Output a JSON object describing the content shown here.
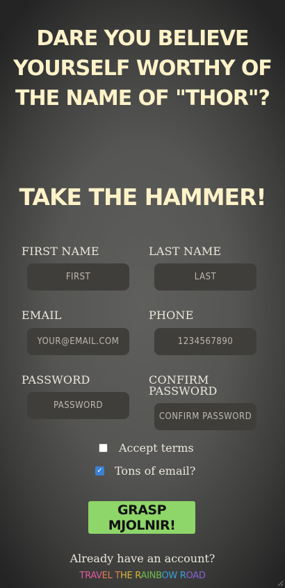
{
  "header": {
    "headline": "Dare you believe yourself worthy of the name of \"Thor\"?",
    "subhead": "Take the hammer!"
  },
  "form": {
    "first_name": {
      "label": "First Name",
      "placeholder": "First"
    },
    "last_name": {
      "label": "Last Name",
      "placeholder": "Last"
    },
    "email": {
      "label": "Email",
      "placeholder": "your@email.com"
    },
    "phone": {
      "label": "Phone",
      "placeholder": "1234567890"
    },
    "password": {
      "label": "Password",
      "placeholder": "Password"
    },
    "confirm_password": {
      "label": "Confirm Password",
      "placeholder": "Confirm Password"
    },
    "accept_terms": {
      "label": "Accept terms",
      "checked": false
    },
    "tons_of_email": {
      "label": "Tons of email?",
      "checked": true
    },
    "submit_label": "Grasp Mjolnir!"
  },
  "footer": {
    "already_text": "Already have an account?",
    "link_text": "Travel the Rainbow Road"
  },
  "colors": {
    "headline": "#fdf2c8",
    "button_bg": "#8ed66a",
    "field_bg": "#403e3b",
    "checkbox_checked": "#3b82d6",
    "rainbow": [
      "#e05a9a",
      "#e0804a",
      "#d8b83a",
      "#6cbf4a",
      "#3a9ed8",
      "#8a62d6"
    ]
  }
}
